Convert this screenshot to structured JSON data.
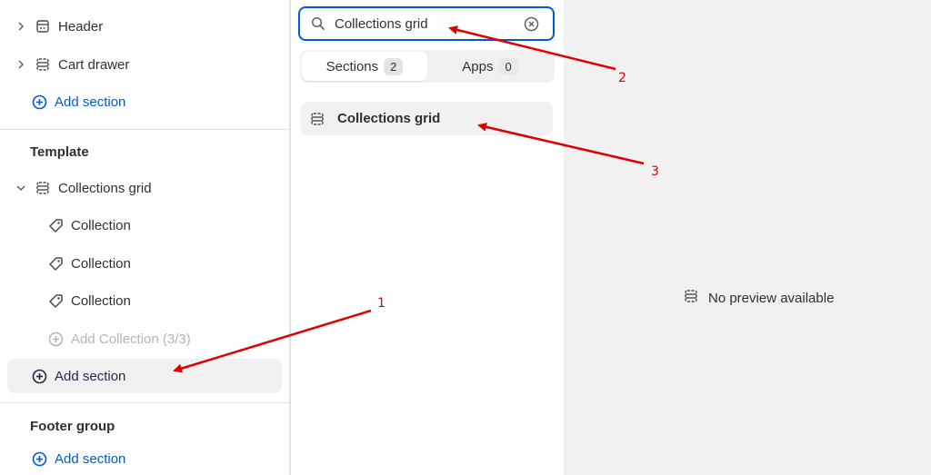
{
  "sidebar": {
    "header_group": [
      {
        "label": "Header",
        "icon": "section-icon"
      },
      {
        "label": "Cart drawer",
        "icon": "section-icon"
      }
    ],
    "header_add_label": "Add section",
    "template_title": "Template",
    "template_section": {
      "label": "Collections grid",
      "icon": "section-icon"
    },
    "blocks": [
      {
        "label": "Collection",
        "icon": "tag-icon"
      },
      {
        "label": "Collection",
        "icon": "tag-icon"
      },
      {
        "label": "Collection",
        "icon": "tag-icon"
      }
    ],
    "add_block_label": "Add Collection (3/3)",
    "template_add_label": "Add section",
    "footer_title": "Footer group",
    "footer_add_label": "Add section"
  },
  "picker": {
    "search_value": "Collections grid",
    "tabs": [
      {
        "label": "Sections",
        "count": "2"
      },
      {
        "label": "Apps",
        "count": "0"
      }
    ],
    "result_label": "Collections grid"
  },
  "preview": {
    "empty_text": "No preview available"
  },
  "annotations": {
    "label_1": "1",
    "label_2": "2",
    "label_3": "3"
  },
  "colors": {
    "link": "#005bd3",
    "annotation": "#e00000",
    "preview_bg": "#f1f1f1"
  }
}
